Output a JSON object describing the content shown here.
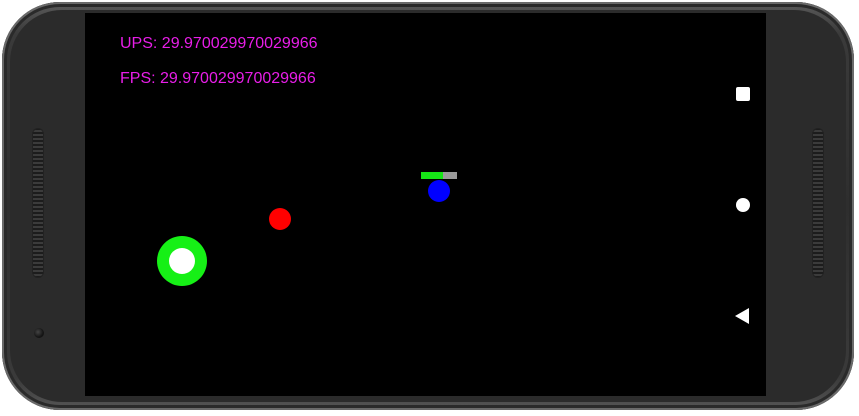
{
  "hud": {
    "ups_text": "UPS: 29.970029970029966",
    "fps_text": "FPS: 29.970029970029966",
    "text_color": "#e81ee8"
  },
  "game": {
    "player": {
      "color": "#0000ff",
      "health_fraction": 0.6,
      "health_color": "#16e616",
      "health_bg_color": "#9a9a9a"
    },
    "enemy": {
      "color": "#ff0000"
    },
    "joystick": {
      "outer_color": "#16f016",
      "inner_color": "#ffffff"
    }
  },
  "navbar": {
    "buttons": [
      {
        "icon": "square-recents-icon"
      },
      {
        "icon": "circle-home-icon"
      },
      {
        "icon": "triangle-back-icon"
      }
    ]
  }
}
